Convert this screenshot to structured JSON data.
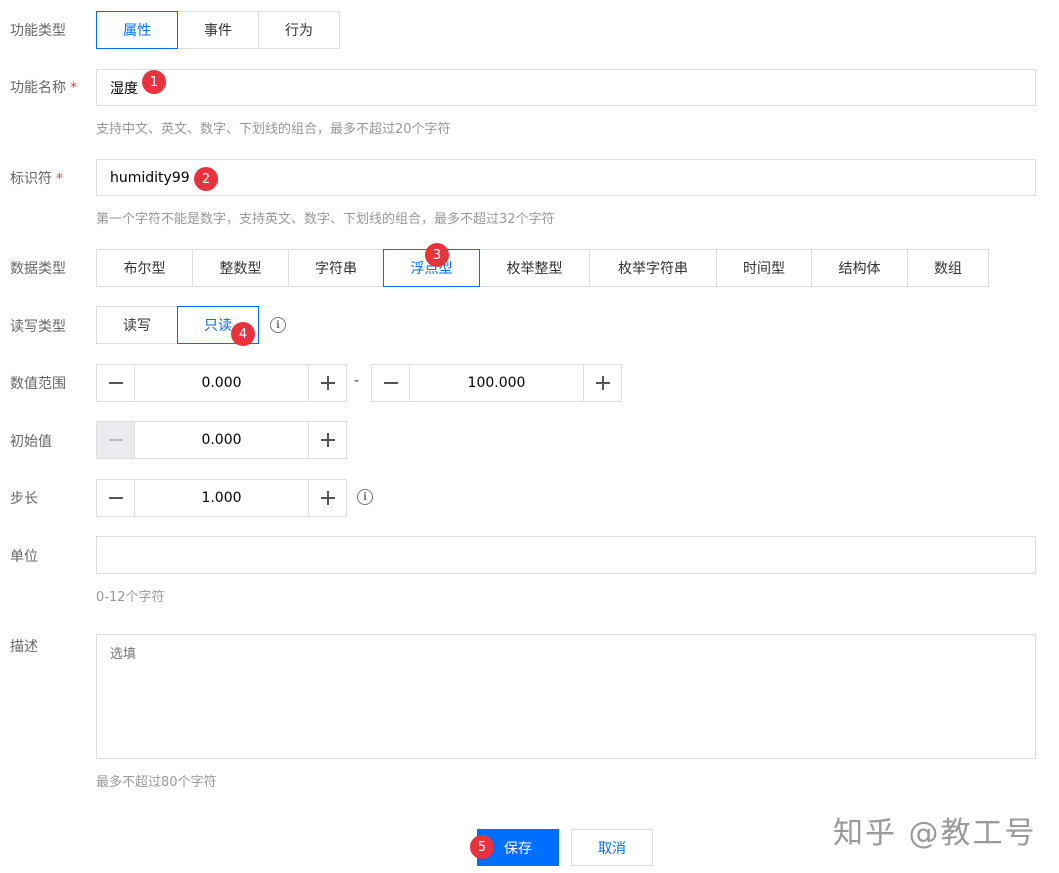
{
  "fields": {
    "function_type": {
      "label": "功能类型",
      "options": [
        "属性",
        "事件",
        "行为"
      ],
      "selected": "属性"
    },
    "function_name": {
      "label": "功能名称",
      "required_mark": "*",
      "value": "湿度",
      "hint": "支持中文、英文、数字、下划线的组合，最多不超过20个字符"
    },
    "identifier": {
      "label": "标识符",
      "required_mark": "*",
      "value": "humidity99",
      "hint": "第一个字符不能是数字，支持英文、数字、下划线的组合，最多不超过32个字符"
    },
    "data_type": {
      "label": "数据类型",
      "options": [
        "布尔型",
        "整数型",
        "字符串",
        "浮点型",
        "枚举整型",
        "枚举字符串",
        "时间型",
        "结构体",
        "数组"
      ],
      "selected": "浮点型"
    },
    "rw_type": {
      "label": "读写类型",
      "options": [
        "读写",
        "只读"
      ],
      "selected": "只读"
    },
    "value_range": {
      "label": "数值范围",
      "min": "0.000",
      "separator": "-",
      "max": "100.000"
    },
    "initial_value": {
      "label": "初始值",
      "value": "0.000"
    },
    "step": {
      "label": "步长",
      "value": "1.000"
    },
    "unit": {
      "label": "单位",
      "value": "",
      "hint": "0-12个字符"
    },
    "description": {
      "label": "描述",
      "placeholder": "选填",
      "hint": "最多不超过80个字符"
    }
  },
  "actions": {
    "save": "保存",
    "cancel": "取消"
  },
  "markers": [
    "1",
    "2",
    "3",
    "4",
    "5"
  ],
  "watermark": "知乎 @教工号",
  "colors": {
    "accent": "#006eff",
    "marker": "#e7333d",
    "border": "#dddddd",
    "required": "#e54545"
  }
}
